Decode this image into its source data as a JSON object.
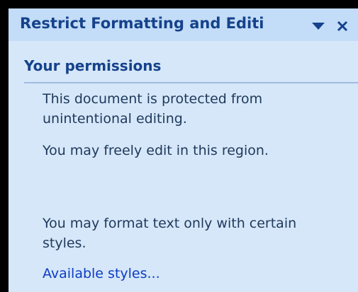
{
  "task_pane": {
    "title": "Restrict Formatting and Editi",
    "menu_icon": "dropdown-triangle-icon",
    "close_icon": "close-x-icon"
  },
  "permissions": {
    "header": "Your permissions",
    "protected_line1": "This document is protected from",
    "protected_line2": "unintentional editing.",
    "edit_region": "You may freely edit in this region.",
    "format_line1": "You may format text only with certain",
    "format_line2": "styles.",
    "available_styles_link": "Available styles..."
  },
  "colors": {
    "background": "#000000",
    "pane": "#d6e7f9",
    "title_text": "#15428b",
    "link": "#0b3cc4"
  }
}
